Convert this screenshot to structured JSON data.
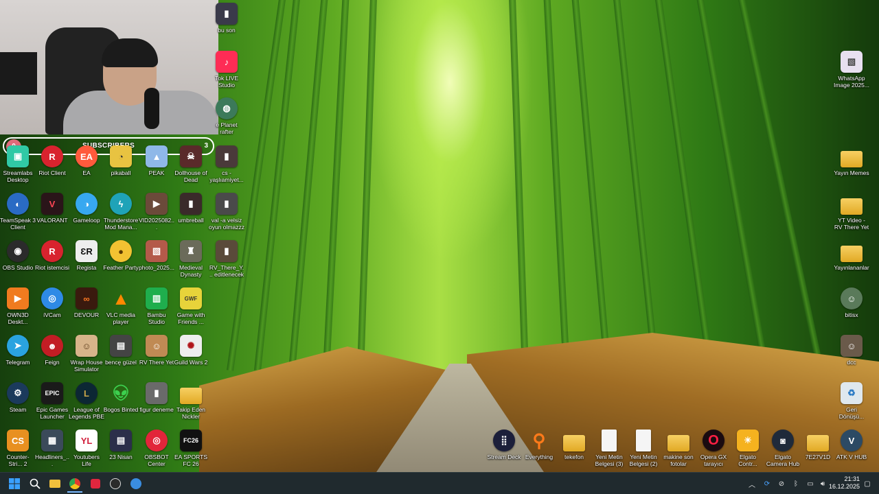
{
  "overlay": {
    "subscribers_label": "SUBSCRIBERS",
    "subscribers_current": "0",
    "subscribers_goal": "3"
  },
  "desktop": {
    "col0": [
      "Streamlabs Desktop",
      "TeamSpeak 3 Client",
      "OBS Studio",
      "OWN3D Deskt...",
      "Telegram",
      "Steam",
      "Counter-Stri... 2"
    ],
    "col1": [
      "Riot Client",
      "VALORANT",
      "Riot istemcisi",
      "iVCam",
      "Feign",
      "Epic Games Launcher",
      "Headliners_..."
    ],
    "col2": [
      "EA",
      "Gameloop",
      "Regista",
      "DEVOUR",
      "Wrap House Simulator",
      "League of Legends PBE",
      "Youtubers Life"
    ],
    "col3": [
      "pikaball",
      "Thunderstore Mod Mana...",
      "Feather Party",
      "VLC media player",
      "bencę güzel",
      "Bogos Binted",
      "23 Nisan"
    ],
    "col4": [
      "PEAK",
      "VID2025082...",
      "photo_2025...",
      "Bambu Studio",
      "RV There Yet",
      "figur deneme",
      "OBSBOT Center"
    ],
    "col5": [
      "Dollhouse of Dead",
      "umbreball",
      "Medieval Dynasty",
      "Game with Friends ...",
      "Guild Wars 2",
      "Takip Eden Nickler",
      "EA SPORTS FC 26"
    ],
    "col6": [
      "bu son",
      "Tok LIVE Studio",
      "e Planet rafter",
      "cs - yaşlıamiyet...",
      "val -a velsiz oyun olmazzz",
      "RV_There_Y... editlenecek"
    ],
    "right": [
      "WhatsApp Image 2025...",
      "Yayın Memes",
      "YT Video - RV There Yet",
      "Yayınlananlar",
      "bitisx",
      "dcc",
      "Geri Dönüşü..."
    ],
    "bottom_row": [
      "Stream Deck",
      "Everything",
      "tekefon",
      "Yeni Metin Belgesi (3)",
      "Yeni Metin Belgesi (2)",
      "makine son fotolar",
      "Opera GX tarayıcı",
      "Elgato Contr...",
      "Elgato Camera Hub",
      "7E27V1D",
      "ATK V HUB"
    ]
  },
  "taskbar": {
    "time": "21:31",
    "date": "16.12.2025"
  },
  "colors": {
    "taskbar_bg": "#202a2e",
    "overlay_dot": "#e06a7a",
    "folder": "#f0c040"
  }
}
